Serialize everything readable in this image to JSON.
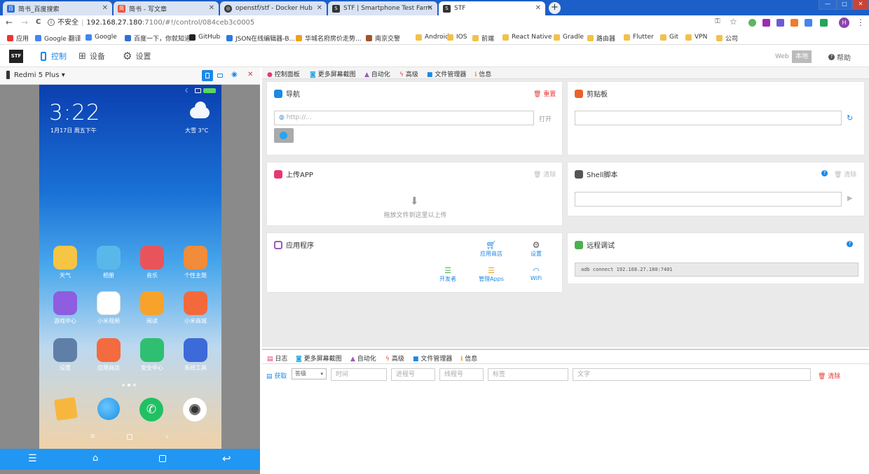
{
  "browser": {
    "tabs": [
      {
        "title": "简书_百度搜索",
        "color": "#2f6fd6",
        "glyph": "百"
      },
      {
        "title": "简书 - 写文章",
        "color": "#e9573f",
        "glyph": "简"
      },
      {
        "title": "openstf/stf - Docker Hub",
        "color": "#3a3a3a",
        "glyph": "◎"
      },
      {
        "title": "STF | Smartphone Test Farm",
        "color": "#333333",
        "glyph": "S"
      },
      {
        "title": "STF",
        "color": "#333333",
        "glyph": "S"
      }
    ],
    "new_tab": "+",
    "close_glyph": "✕",
    "win_minimize": "—",
    "win_maximize": "□",
    "win_close": "✕",
    "back": "←",
    "forward": "→",
    "reload": "C",
    "security": "不安全",
    "url_host": "192.168.27.180",
    "url_rest": ":7100/#!/control/084ceb3c0005",
    "bookmarks": [
      {
        "label": "应用",
        "color": "#e33"
      },
      {
        "label": "Google 翻译",
        "color": "#4285f4"
      },
      {
        "label": "Google",
        "color": "#4285f4"
      },
      {
        "label": "百度一下，你就知道",
        "color": "#2f6fd6"
      },
      {
        "label": "GitHub",
        "color": "#222"
      },
      {
        "label": "JSON在线编辑器-B...",
        "color": "#2a7ae2"
      },
      {
        "label": "华城名府房价走势...",
        "color": "#f0a020"
      },
      {
        "label": "南京交警",
        "color": "#a0522d"
      },
      {
        "label": "Android",
        "color": "#f1c14b"
      },
      {
        "label": "IOS",
        "color": "#f1c14b"
      },
      {
        "label": "前端",
        "color": "#f1c14b"
      },
      {
        "label": "React Native",
        "color": "#f1c14b"
      },
      {
        "label": "Gradle",
        "color": "#f1c14b"
      },
      {
        "label": "路由器",
        "color": "#f1c14b"
      },
      {
        "label": "Flutter",
        "color": "#f1c14b"
      },
      {
        "label": "Git",
        "color": "#f1c14b"
      },
      {
        "label": "VPN",
        "color": "#f1c14b"
      },
      {
        "label": "公司",
        "color": "#f1c14b"
      }
    ]
  },
  "stf": {
    "logo": "STF",
    "nav": {
      "control": "控制",
      "devices": "设备",
      "settings": "设置"
    },
    "web": "Web",
    "local": "本地",
    "help": "帮助",
    "device_name": "Redmi 5 Plus",
    "accent": "#1e88e5"
  },
  "phone": {
    "time": "3:22",
    "date": "1月17日 周五下午",
    "weather": "大雪  3°C",
    "apps": [
      {
        "label": "天气",
        "color": "#f6c544"
      },
      {
        "label": "相册",
        "color": "#5ab7ea"
      },
      {
        "label": "音乐",
        "color": "#e9545a"
      },
      {
        "label": "个性主题",
        "color": "#f08c3a"
      },
      {
        "label": "游戏中心",
        "color": "#8e5de0"
      },
      {
        "label": "小米视频",
        "color": "#ffffff"
      },
      {
        "label": "阅读",
        "color": "#f7a32b"
      },
      {
        "label": "小米商城",
        "color": "#f26a3b"
      },
      {
        "label": "设置",
        "color": "#5f7fa8"
      },
      {
        "label": "应用商店",
        "color": "#f36b3f"
      },
      {
        "label": "安全中心",
        "color": "#2fbf71"
      },
      {
        "label": "系统工具",
        "color": "#3c6ad8"
      }
    ],
    "dock": [
      {
        "name": "notes",
        "color": "#f7b73f"
      },
      {
        "name": "browser",
        "color": "#2aa3ef"
      },
      {
        "name": "phone",
        "color": "#21c063"
      },
      {
        "name": "camera",
        "color": "#ffffff"
      }
    ]
  },
  "tabs_top": [
    "控制面板",
    "更多屏幕截图",
    "自动化",
    "高级",
    "文件管理器",
    "信息"
  ],
  "nav_panel": {
    "title": "导航",
    "reset": "重置",
    "placeholder": "http://...",
    "open": "打开"
  },
  "clipboard": {
    "title": "剪贴板"
  },
  "upload": {
    "title": "上传APP",
    "clear": "清除",
    "drop": "拖放文件到这里以上传"
  },
  "shell": {
    "title": "Shell脚本",
    "clear": "清除"
  },
  "apps_panel": {
    "title": "应用程序",
    "items": [
      {
        "label": "应用商店",
        "icon": "cart-icon"
      },
      {
        "label": "设置",
        "icon": "gear-icon"
      },
      {
        "label": "开发者",
        "icon": "sliders-icon"
      },
      {
        "label": "管理Apps",
        "icon": "list-icon"
      },
      {
        "label": "WiFi",
        "icon": "wifi-icon"
      }
    ]
  },
  "remote": {
    "title": "远程调试",
    "command": "adb connect 192.168.27.180:7401"
  },
  "tabs_bottom": [
    "日志",
    "更多屏幕截图",
    "自动化",
    "高级",
    "文件管理器",
    "信息"
  ],
  "log": {
    "get": "获取",
    "level": "答级",
    "time_ph": "时间",
    "pid_ph": "进程号",
    "tid_ph": "线程号",
    "tag_ph": "标签",
    "text_ph": "文字",
    "clear": "清除"
  }
}
